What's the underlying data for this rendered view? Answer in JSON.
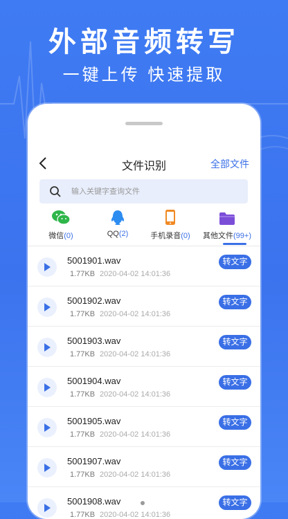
{
  "promo": {
    "title": "外部音频转写",
    "subtitle": "一键上传 快速提取"
  },
  "header": {
    "title": "文件识别",
    "all_files": "全部文件"
  },
  "search": {
    "placeholder": "输入关键字查询文件"
  },
  "categories": [
    {
      "label": "微信",
      "count": "(0)",
      "icon": "wechat-icon",
      "color": "#2fb64a"
    },
    {
      "label": "QQ",
      "count": "(2)",
      "icon": "qq-icon",
      "color": "#2d8cf0"
    },
    {
      "label": "手机录音",
      "count": "(0)",
      "icon": "phone-record-icon",
      "color": "#f08a24"
    },
    {
      "label": "其他文件",
      "count": "(99+)",
      "icon": "folder-icon",
      "color": "#7b4ed8",
      "active": true
    }
  ],
  "files": [
    {
      "name": "5001901.wav",
      "size": "1.77KB",
      "date": "2020-04-02 14:01:36"
    },
    {
      "name": "5001902.wav",
      "size": "1.77KB",
      "date": "2020-04-02 14:01:36"
    },
    {
      "name": "5001903.wav",
      "size": "1.77KB",
      "date": "2020-04-02 14:01:36"
    },
    {
      "name": "5001904.wav",
      "size": "1.77KB",
      "date": "2020-04-02 14:01:36"
    },
    {
      "name": "5001905.wav",
      "size": "1.77KB",
      "date": "2020-04-02 14:01:36"
    },
    {
      "name": "5001907.wav",
      "size": "1.77KB",
      "date": "2020-04-02 14:01:36"
    },
    {
      "name": "5001908.wav",
      "size": "1.77KB",
      "date": "2020-04-02 14:01:36"
    }
  ],
  "convert_label": "转文字",
  "colors": {
    "accent": "#3a6fe6",
    "background": "#3f7bf3"
  }
}
